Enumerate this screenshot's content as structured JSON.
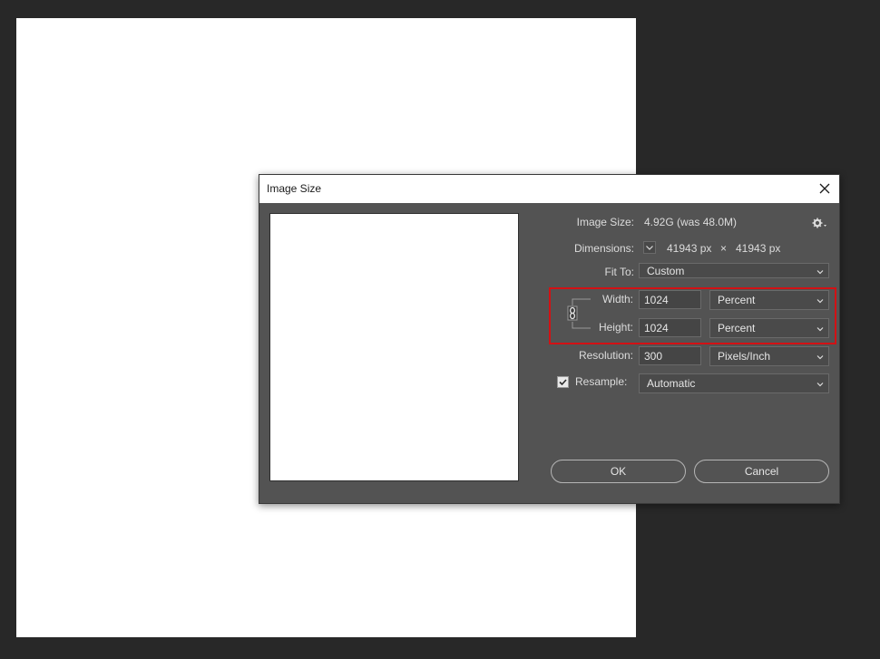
{
  "dialog": {
    "title": "Image Size",
    "image_size_label": "Image Size:",
    "image_size_value": "4.92G (was 48.0M)",
    "dimensions_label": "Dimensions:",
    "dimensions_width": "41943 px",
    "dimensions_x": "×",
    "dimensions_height": "41943 px",
    "fit_to_label": "Fit To:",
    "fit_to_value": "Custom",
    "width_label": "Width:",
    "width_value": "1024",
    "width_unit": "Percent",
    "height_label": "Height:",
    "height_value": "1024",
    "height_unit": "Percent",
    "resolution_label": "Resolution:",
    "resolution_value": "300",
    "resolution_unit": "Pixels/Inch",
    "resample_label": "Resample:",
    "resample_checked": true,
    "resample_value": "Automatic",
    "ok_label": "OK",
    "cancel_label": "Cancel"
  },
  "colors": {
    "workspace_bg": "#282828",
    "dialog_bg": "#535353",
    "highlight": "#d31114"
  }
}
